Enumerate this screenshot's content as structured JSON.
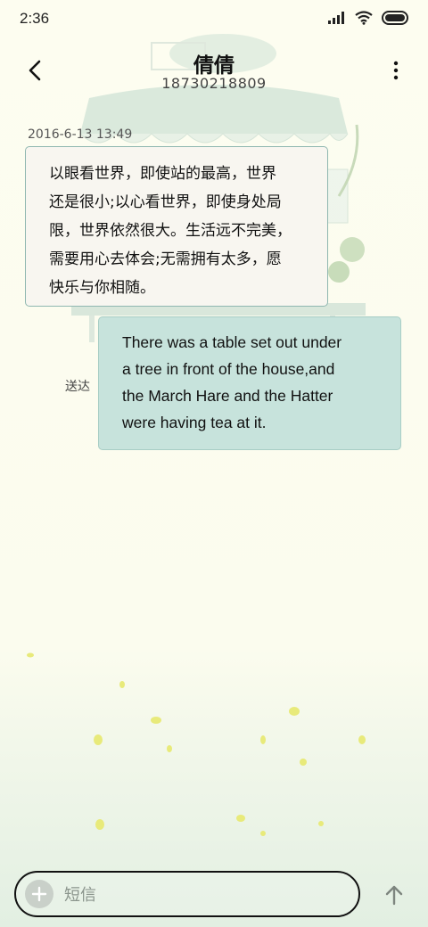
{
  "status_bar": {
    "time": "2:36",
    "icons": [
      "signal-icon",
      "wifi-icon",
      "battery-icon"
    ]
  },
  "header": {
    "contact_name": "倩倩",
    "contact_number": "18730218809",
    "back_icon": "back-arrow-icon",
    "more_icon": "more-vertical-icon"
  },
  "conversation": {
    "timestamp": "2016-6-13 13:49",
    "incoming": {
      "lines": [
        "以眼看世界，即使站的最高，世界",
        "还是很小;以心看世界，即使身处局",
        "限，世界依然很大。生活远不完美，",
        "需要用心去体会;无需拥有太多，愿",
        "快乐与你相随。"
      ]
    },
    "outgoing": {
      "lines": [
        "There was a table set out under",
        "a tree in front of the house,and",
        "the March Hare and the Hatter",
        "were having tea at it."
      ],
      "status": "送达"
    }
  },
  "composer": {
    "placeholder": "短信",
    "add_icon": "plus-icon",
    "send_icon": "send-arrow-icon"
  },
  "colors": {
    "background": "#fdfdf0",
    "outgoing_bubble": "#c7e3dc",
    "incoming_bubble": "#f8f6f0",
    "bubble_border": "#8fb7b0"
  }
}
